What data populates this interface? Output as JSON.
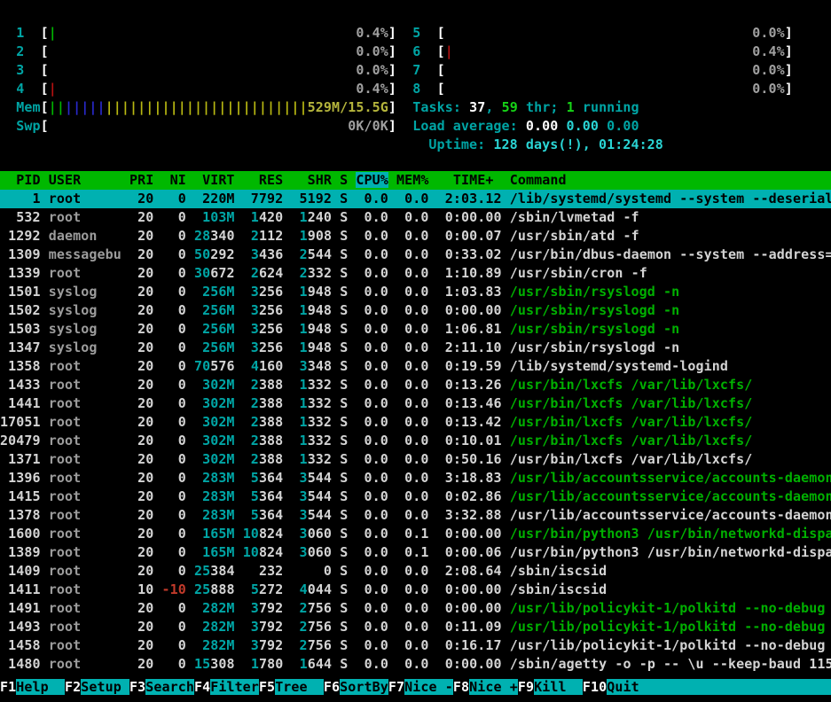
{
  "palette": {
    "bg": "#000000",
    "fg": "#d4d4d4",
    "bold": "#ffffff",
    "gray": "#a0a0a0",
    "user_gray": "#9c9c9c",
    "cyan": "#00a5a5",
    "cyan_bright": "#2ad4d4",
    "green": "#00b000",
    "green_bright": "#16d416",
    "red": "#c23a2a",
    "bar_green": "#00b400",
    "bar_red": "#b31111",
    "bar_blue": "#2929cc",
    "bar_yellow": "#b8b812",
    "mem_text": "#b5b53c",
    "sel_bg": "#00b1b1",
    "hdr_bg": "#00b800"
  },
  "meters": {
    "bar_inner_width": 42,
    "left": [
      {
        "name": "cpu1",
        "label": "1",
        "bars": [
          [
            "bar_green",
            1
          ]
        ],
        "value": "0.4%",
        "value_color": "gray"
      },
      {
        "name": "cpu2",
        "label": "2",
        "bars": [],
        "value": "0.0%",
        "value_color": "gray"
      },
      {
        "name": "cpu3",
        "label": "3",
        "bars": [],
        "value": "0.0%",
        "value_color": "gray"
      },
      {
        "name": "cpu4",
        "label": "4",
        "bars": [
          [
            "bar_red",
            1
          ]
        ],
        "value": "0.4%",
        "value_color": "gray"
      },
      {
        "name": "mem",
        "label": "Mem",
        "bars": [
          [
            "bar_green",
            2
          ],
          [
            "bar_blue",
            5
          ],
          [
            "bar_yellow",
            25
          ]
        ],
        "value": "529M/15.5G",
        "value_color": "mem_text"
      },
      {
        "name": "swp",
        "label": "Swp",
        "bars": [],
        "value": "0K/0K",
        "value_color": "gray"
      }
    ],
    "right": [
      {
        "name": "cpu5",
        "label": "5",
        "bars": [],
        "value": "0.0%",
        "value_color": "gray"
      },
      {
        "name": "cpu6",
        "label": "6",
        "bars": [
          [
            "bar_red",
            1
          ]
        ],
        "value": "0.4%",
        "value_color": "gray"
      },
      {
        "name": "cpu7",
        "label": "7",
        "bars": [],
        "value": "0.0%",
        "value_color": "gray"
      },
      {
        "name": "cpu8",
        "label": "8",
        "bars": [],
        "value": "0.0%",
        "value_color": "gray"
      }
    ]
  },
  "info": {
    "tasks": [
      [
        "Tasks: ",
        "cyan"
      ],
      [
        "37",
        "bold"
      ],
      [
        ", ",
        "cyan"
      ],
      [
        "59",
        "green_bright"
      ],
      [
        " thr; ",
        "cyan"
      ],
      [
        "1",
        "green_bright"
      ],
      [
        " running",
        "cyan"
      ]
    ],
    "load": [
      [
        "Load average: ",
        "cyan"
      ],
      [
        "0.00 ",
        "bold"
      ],
      [
        "0.00 ",
        "cyan_bright"
      ],
      [
        "0.00",
        "cyan"
      ]
    ],
    "uptime": [
      [
        "Uptime: ",
        "cyan"
      ],
      [
        "128 days(!), 01:24:28",
        "cyan_bright"
      ]
    ]
  },
  "table": {
    "total_cols": 103,
    "columns": [
      {
        "title": "PID",
        "width": 5,
        "align": "right"
      },
      {
        "title": "USER",
        "width": 9,
        "align": "left"
      },
      {
        "title": "PRI",
        "width": 3,
        "align": "right"
      },
      {
        "title": "NI",
        "width": 3,
        "align": "right"
      },
      {
        "title": "VIRT",
        "width": 5,
        "align": "right"
      },
      {
        "title": "RES",
        "width": 5,
        "align": "right"
      },
      {
        "title": "SHR",
        "width": 5,
        "align": "right"
      },
      {
        "title": "S",
        "width": 1,
        "align": "left"
      },
      {
        "title": "CPU%",
        "width": 4,
        "align": "right"
      },
      {
        "title": "MEM%",
        "width": 4,
        "align": "right"
      },
      {
        "title": "  TIME+ ",
        "width": 8,
        "align": "literal"
      },
      {
        "title": "Command",
        "width": 40,
        "align": "left"
      }
    ],
    "sort_column": "CPU%",
    "rows": [
      {
        "pid": "1",
        "user": "root",
        "pri": "20",
        "ni": "0",
        "virt": "220M",
        "res": "7792",
        "shr": "5192",
        "s": "S",
        "cpu": "0.0",
        "mem": "0.0",
        "time": "2:03.12",
        "cmd": "/lib/systemd/systemd --system --deserial",
        "sel": true
      },
      {
        "pid": "532",
        "user": "root",
        "pri": "20",
        "ni": "0",
        "virt": "103M",
        "res": "1420",
        "shr": "1240",
        "s": "S",
        "cpu": "0.0",
        "mem": "0.0",
        "time": "0:00.00",
        "cmd": "/sbin/lvmetad -f"
      },
      {
        "pid": "1292",
        "user": "daemon",
        "pri": "20",
        "ni": "0",
        "virt": "28340",
        "res": "2112",
        "shr": "1908",
        "s": "S",
        "cpu": "0.0",
        "mem": "0.0",
        "time": "0:00.07",
        "cmd": "/usr/sbin/atd -f"
      },
      {
        "pid": "1309",
        "user": "messagebu",
        "pri": "20",
        "ni": "0",
        "virt": "50292",
        "res": "3436",
        "shr": "2544",
        "s": "S",
        "cpu": "0.0",
        "mem": "0.0",
        "time": "0:33.02",
        "cmd": "/usr/bin/dbus-daemon --system --address="
      },
      {
        "pid": "1339",
        "user": "root",
        "pri": "20",
        "ni": "0",
        "virt": "30672",
        "res": "2624",
        "shr": "2332",
        "s": "S",
        "cpu": "0.0",
        "mem": "0.0",
        "time": "1:10.89",
        "cmd": "/usr/sbin/cron -f"
      },
      {
        "pid": "1501",
        "user": "syslog",
        "pri": "20",
        "ni": "0",
        "virt": "256M",
        "res": "3256",
        "shr": "1948",
        "s": "S",
        "cpu": "0.0",
        "mem": "0.0",
        "time": "1:03.83",
        "cmd": "/usr/sbin/rsyslogd -n",
        "thr": true
      },
      {
        "pid": "1502",
        "user": "syslog",
        "pri": "20",
        "ni": "0",
        "virt": "256M",
        "res": "3256",
        "shr": "1948",
        "s": "S",
        "cpu": "0.0",
        "mem": "0.0",
        "time": "0:00.00",
        "cmd": "/usr/sbin/rsyslogd -n",
        "thr": true
      },
      {
        "pid": "1503",
        "user": "syslog",
        "pri": "20",
        "ni": "0",
        "virt": "256M",
        "res": "3256",
        "shr": "1948",
        "s": "S",
        "cpu": "0.0",
        "mem": "0.0",
        "time": "1:06.81",
        "cmd": "/usr/sbin/rsyslogd -n",
        "thr": true
      },
      {
        "pid": "1347",
        "user": "syslog",
        "pri": "20",
        "ni": "0",
        "virt": "256M",
        "res": "3256",
        "shr": "1948",
        "s": "S",
        "cpu": "0.0",
        "mem": "0.0",
        "time": "2:11.10",
        "cmd": "/usr/sbin/rsyslogd -n"
      },
      {
        "pid": "1358",
        "user": "root",
        "pri": "20",
        "ni": "0",
        "virt": "70576",
        "res": "4160",
        "shr": "3348",
        "s": "S",
        "cpu": "0.0",
        "mem": "0.0",
        "time": "0:19.59",
        "cmd": "/lib/systemd/systemd-logind"
      },
      {
        "pid": "1433",
        "user": "root",
        "pri": "20",
        "ni": "0",
        "virt": "302M",
        "res": "2388",
        "shr": "1332",
        "s": "S",
        "cpu": "0.0",
        "mem": "0.0",
        "time": "0:13.26",
        "cmd": "/usr/bin/lxcfs /var/lib/lxcfs/",
        "thr": true
      },
      {
        "pid": "1441",
        "user": "root",
        "pri": "20",
        "ni": "0",
        "virt": "302M",
        "res": "2388",
        "shr": "1332",
        "s": "S",
        "cpu": "0.0",
        "mem": "0.0",
        "time": "0:13.46",
        "cmd": "/usr/bin/lxcfs /var/lib/lxcfs/",
        "thr": true
      },
      {
        "pid": "17051",
        "user": "root",
        "pri": "20",
        "ni": "0",
        "virt": "302M",
        "res": "2388",
        "shr": "1332",
        "s": "S",
        "cpu": "0.0",
        "mem": "0.0",
        "time": "0:13.42",
        "cmd": "/usr/bin/lxcfs /var/lib/lxcfs/",
        "thr": true
      },
      {
        "pid": "20479",
        "user": "root",
        "pri": "20",
        "ni": "0",
        "virt": "302M",
        "res": "2388",
        "shr": "1332",
        "s": "S",
        "cpu": "0.0",
        "mem": "0.0",
        "time": "0:10.01",
        "cmd": "/usr/bin/lxcfs /var/lib/lxcfs/",
        "thr": true
      },
      {
        "pid": "1371",
        "user": "root",
        "pri": "20",
        "ni": "0",
        "virt": "302M",
        "res": "2388",
        "shr": "1332",
        "s": "S",
        "cpu": "0.0",
        "mem": "0.0",
        "time": "0:50.16",
        "cmd": "/usr/bin/lxcfs /var/lib/lxcfs/"
      },
      {
        "pid": "1396",
        "user": "root",
        "pri": "20",
        "ni": "0",
        "virt": "283M",
        "res": "5364",
        "shr": "3544",
        "s": "S",
        "cpu": "0.0",
        "mem": "0.0",
        "time": "3:18.83",
        "cmd": "/usr/lib/accountsservice/accounts-daemon",
        "thr": true
      },
      {
        "pid": "1415",
        "user": "root",
        "pri": "20",
        "ni": "0",
        "virt": "283M",
        "res": "5364",
        "shr": "3544",
        "s": "S",
        "cpu": "0.0",
        "mem": "0.0",
        "time": "0:02.86",
        "cmd": "/usr/lib/accountsservice/accounts-daemon",
        "thr": true
      },
      {
        "pid": "1378",
        "user": "root",
        "pri": "20",
        "ni": "0",
        "virt": "283M",
        "res": "5364",
        "shr": "3544",
        "s": "S",
        "cpu": "0.0",
        "mem": "0.0",
        "time": "3:32.88",
        "cmd": "/usr/lib/accountsservice/accounts-daemon"
      },
      {
        "pid": "1600",
        "user": "root",
        "pri": "20",
        "ni": "0",
        "virt": "165M",
        "res": "10824",
        "shr": "3060",
        "s": "S",
        "cpu": "0.0",
        "mem": "0.1",
        "time": "0:00.00",
        "cmd": "/usr/bin/python3 /usr/bin/networkd-dispa",
        "thr": true
      },
      {
        "pid": "1389",
        "user": "root",
        "pri": "20",
        "ni": "0",
        "virt": "165M",
        "res": "10824",
        "shr": "3060",
        "s": "S",
        "cpu": "0.0",
        "mem": "0.1",
        "time": "0:00.06",
        "cmd": "/usr/bin/python3 /usr/bin/networkd-dispa"
      },
      {
        "pid": "1409",
        "user": "root",
        "pri": "20",
        "ni": "0",
        "virt": "25384",
        "res": "232",
        "shr": "0",
        "s": "S",
        "cpu": "0.0",
        "mem": "0.0",
        "time": "2:08.64",
        "cmd": "/sbin/iscsid"
      },
      {
        "pid": "1411",
        "user": "root",
        "pri": "10",
        "ni": "-10",
        "virt": "25888",
        "res": "5272",
        "shr": "4044",
        "s": "S",
        "cpu": "0.0",
        "mem": "0.0",
        "time": "0:00.00",
        "cmd": "/sbin/iscsid",
        "nired": true
      },
      {
        "pid": "1491",
        "user": "root",
        "pri": "20",
        "ni": "0",
        "virt": "282M",
        "res": "3792",
        "shr": "2756",
        "s": "S",
        "cpu": "0.0",
        "mem": "0.0",
        "time": "0:00.00",
        "cmd": "/usr/lib/policykit-1/polkitd --no-debug",
        "thr": true
      },
      {
        "pid": "1493",
        "user": "root",
        "pri": "20",
        "ni": "0",
        "virt": "282M",
        "res": "3792",
        "shr": "2756",
        "s": "S",
        "cpu": "0.0",
        "mem": "0.0",
        "time": "0:11.09",
        "cmd": "/usr/lib/policykit-1/polkitd --no-debug",
        "thr": true
      },
      {
        "pid": "1458",
        "user": "root",
        "pri": "20",
        "ni": "0",
        "virt": "282M",
        "res": "3792",
        "shr": "2756",
        "s": "S",
        "cpu": "0.0",
        "mem": "0.0",
        "time": "0:16.17",
        "cmd": "/usr/lib/policykit-1/polkitd --no-debug"
      },
      {
        "pid": "1480",
        "user": "root",
        "pri": "20",
        "ni": "0",
        "virt": "15308",
        "res": "1780",
        "shr": "1644",
        "s": "S",
        "cpu": "0.0",
        "mem": "0.0",
        "time": "0:00.00",
        "cmd": "/sbin/agetty -o -p -- \\u --keep-baud 115"
      }
    ]
  },
  "fkeys": [
    {
      "key": "F1",
      "label": "Help  "
    },
    {
      "key": "F2",
      "label": "Setup "
    },
    {
      "key": "F3",
      "label": "Search"
    },
    {
      "key": "F4",
      "label": "Filter"
    },
    {
      "key": "F5",
      "label": "Tree  "
    },
    {
      "key": "F6",
      "label": "SortBy"
    },
    {
      "key": "F7",
      "label": "Nice -"
    },
    {
      "key": "F8",
      "label": "Nice +"
    },
    {
      "key": "F9",
      "label": "Kill  "
    },
    {
      "key": "F10",
      "label": "Quit  "
    }
  ]
}
